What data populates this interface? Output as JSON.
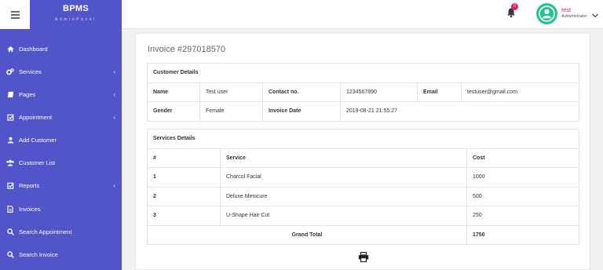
{
  "brand": {
    "title": "BPMS",
    "subtitle": "AdminPanel"
  },
  "sidebar": {
    "items": [
      {
        "label": "Dashboard",
        "icon": "home-icon",
        "has_submenu": false
      },
      {
        "label": "Services",
        "icon": "cogs-icon",
        "has_submenu": true
      },
      {
        "label": "Pages",
        "icon": "book-icon",
        "has_submenu": true
      },
      {
        "label": "Appointment",
        "icon": "checkbox-icon",
        "has_submenu": true
      },
      {
        "label": "Add Customer",
        "icon": "user-icon",
        "has_submenu": false
      },
      {
        "label": "Customer List",
        "icon": "users-icon",
        "has_submenu": false
      },
      {
        "label": "Reports",
        "icon": "checkbox-icon",
        "has_submenu": true
      },
      {
        "label": "Invoices",
        "icon": "file-icon",
        "has_submenu": false
      },
      {
        "label": "Search Appointment",
        "icon": "search-icon",
        "has_submenu": false
      },
      {
        "label": "Search Invoice",
        "icon": "search-icon",
        "has_submenu": false
      }
    ],
    "caret": "‹"
  },
  "header": {
    "notification_count": "0",
    "user_name": "test",
    "user_role": "Administrator"
  },
  "invoice": {
    "title": "Invoice #297018570",
    "customer_section": "Customer Details",
    "name_label": "Name",
    "name_value": "Test user",
    "contact_label": "Contact no.",
    "contact_value": "1234567890",
    "email_label": "Email",
    "email_value": "testuser@gmail.com",
    "gender_label": "Gender",
    "gender_value": "Female",
    "date_label": "Invoice Date",
    "date_value": "2019-08-21 21:55:27",
    "services_section": "Services Details",
    "columns": [
      "#",
      "Service",
      "Cost"
    ],
    "services": [
      {
        "num": "1",
        "service": "Charcol Facial",
        "cost": "1000"
      },
      {
        "num": "2",
        "service": "Deluxe Menicure",
        "cost": "500"
      },
      {
        "num": "3",
        "service": "U-Shape Hair Cut",
        "cost": "250"
      }
    ],
    "grand_total_label": "Grand Total",
    "grand_total_value": "1750"
  },
  "colors": {
    "sidebar": "#5254c9",
    "accent": "#e0245e",
    "avatar": "#23c492"
  }
}
